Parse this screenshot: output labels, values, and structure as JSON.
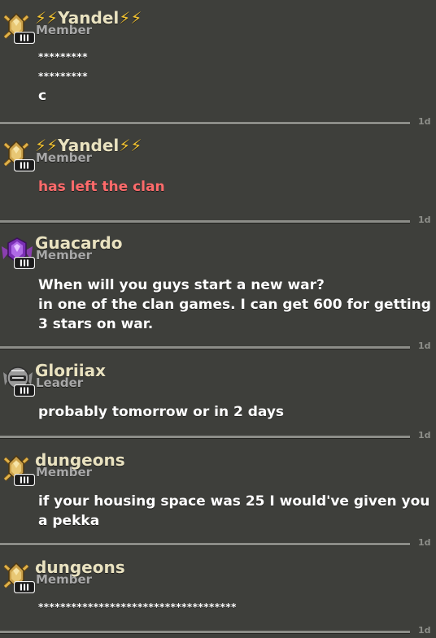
{
  "messages": [
    {
      "name": "⚡⚡Yandel⚡⚡",
      "role": "Member",
      "badge": "gold-crossed-swords-badge",
      "lines": [
        "*********",
        "*********",
        "c"
      ],
      "time": "1d"
    },
    {
      "name": "⚡⚡Yandel⚡⚡",
      "role": "Member",
      "badge": "gold-crossed-swords-badge",
      "lines": [
        "has left the clan"
      ],
      "time": "1d",
      "system": true
    },
    {
      "name": "Guacardo",
      "role": "Member",
      "badge": "purple-crystal-badge",
      "lines": [
        "When will you guys start a new war?",
        "in one of the clan games. I can get 600 for getting",
        "3 stars on war."
      ],
      "time": "1d"
    },
    {
      "name": "Gloriiax",
      "role": "Leader",
      "badge": "silver-helmet-badge",
      "lines": [
        "probably tomorrow or in 2 days"
      ],
      "time": "1d"
    },
    {
      "name": "dungeons",
      "role": "Member",
      "badge": "gold-crossed-swords-badge",
      "lines": [
        "if your housing space was 25 I would've given you",
        "a pekka"
      ],
      "time": "1d"
    },
    {
      "name": "dungeons",
      "role": "Member",
      "badge": "gold-crossed-swords-badge",
      "lines": [
        "************************************"
      ],
      "time": "1d"
    }
  ],
  "badge_level": "III",
  "colors": {
    "name": "#e9e2c0",
    "role": "#a8a8a8",
    "system_text": "#ff6b6b",
    "lightning": "#f1c232",
    "background": "#3e3f3b"
  }
}
